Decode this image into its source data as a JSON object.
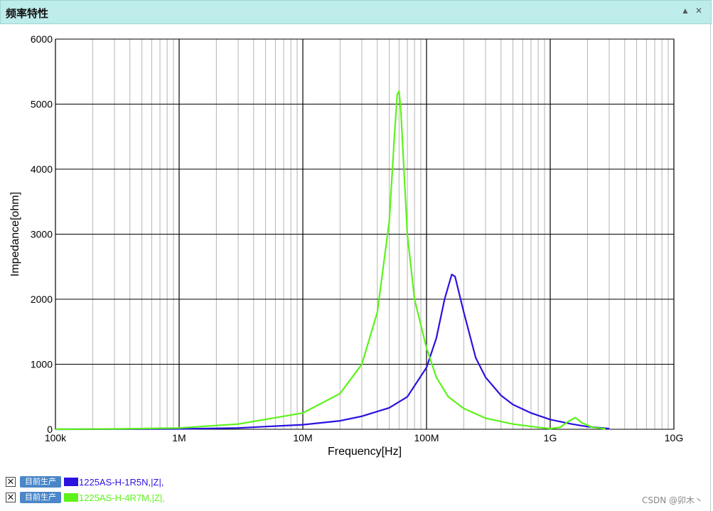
{
  "window": {
    "title": "频率特性"
  },
  "controls": {
    "collapse_glyph": "▲",
    "close_glyph": "✕"
  },
  "chart_data": {
    "type": "line",
    "xscale": "log",
    "xlim": [
      100000,
      10000000000
    ],
    "ylim": [
      0,
      6000
    ],
    "xlabel": "Frequency[Hz]",
    "ylabel": "Impedance[ohm]",
    "xticks": [
      {
        "value": 100000,
        "label": "100k"
      },
      {
        "value": 1000000,
        "label": "1M"
      },
      {
        "value": 10000000,
        "label": "10M"
      },
      {
        "value": 100000000,
        "label": "100M"
      },
      {
        "value": 1000000000,
        "label": "1G"
      },
      {
        "value": 10000000000,
        "label": "10G"
      }
    ],
    "yticks": [
      0,
      1000,
      2000,
      3000,
      4000,
      5000,
      6000
    ],
    "grid": true,
    "series": [
      {
        "name": "1225AS-H-1R5N,|Z|,",
        "color": "#2a12e0",
        "points": [
          [
            100000,
            0
          ],
          [
            1000000,
            5
          ],
          [
            3000000,
            20
          ],
          [
            10000000,
            70
          ],
          [
            20000000,
            130
          ],
          [
            30000000,
            200
          ],
          [
            50000000,
            330
          ],
          [
            70000000,
            500
          ],
          [
            100000000,
            950
          ],
          [
            120000000,
            1400
          ],
          [
            140000000,
            2000
          ],
          [
            160000000,
            2380
          ],
          [
            170000000,
            2350
          ],
          [
            200000000,
            1800
          ],
          [
            250000000,
            1100
          ],
          [
            300000000,
            800
          ],
          [
            400000000,
            520
          ],
          [
            500000000,
            380
          ],
          [
            700000000,
            250
          ],
          [
            1000000000,
            150
          ],
          [
            1500000000,
            80
          ],
          [
            2000000000,
            40
          ],
          [
            3000000000,
            10
          ]
        ]
      },
      {
        "name": "1225AS-H-4R7M,|Z|,",
        "color": "#5cf21a",
        "points": [
          [
            100000,
            0
          ],
          [
            300000,
            5
          ],
          [
            1000000,
            20
          ],
          [
            3000000,
            80
          ],
          [
            10000000,
            250
          ],
          [
            20000000,
            550
          ],
          [
            30000000,
            1000
          ],
          [
            40000000,
            1800
          ],
          [
            50000000,
            3200
          ],
          [
            55000000,
            4500
          ],
          [
            58000000,
            5150
          ],
          [
            60000000,
            5200
          ],
          [
            62000000,
            4900
          ],
          [
            70000000,
            3000
          ],
          [
            80000000,
            2000
          ],
          [
            100000000,
            1250
          ],
          [
            120000000,
            800
          ],
          [
            150000000,
            500
          ],
          [
            200000000,
            320
          ],
          [
            300000000,
            170
          ],
          [
            500000000,
            80
          ],
          [
            800000000,
            30
          ],
          [
            1000000000,
            10
          ],
          [
            1200000000,
            30
          ],
          [
            1400000000,
            120
          ],
          [
            1600000000,
            180
          ],
          [
            1800000000,
            100
          ],
          [
            2200000000,
            30
          ],
          [
            2800000000,
            5
          ]
        ]
      }
    ]
  },
  "legend": {
    "badge_label": "目前生产",
    "close_glyph": "✕",
    "items": [
      {
        "name": "1225AS-H-1R5N,|Z|,",
        "color": "#2a12e0"
      },
      {
        "name": "1225AS-H-4R7M,|Z|,",
        "color": "#5cf21a"
      }
    ]
  },
  "watermark": {
    "text": "CSDN @卯木丶"
  }
}
